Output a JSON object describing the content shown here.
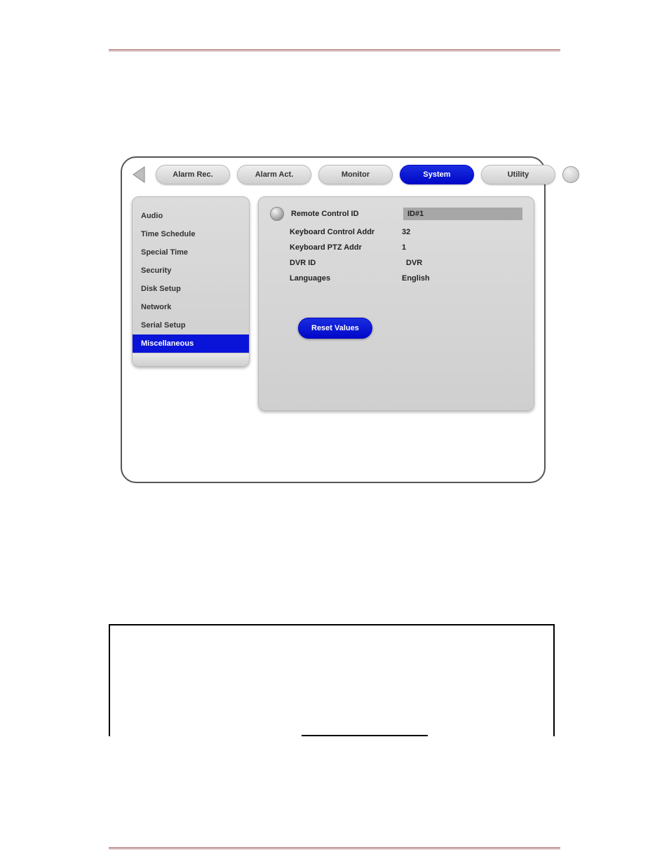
{
  "tabs": {
    "items": [
      {
        "label": "Alarm Rec."
      },
      {
        "label": "Alarm Act."
      },
      {
        "label": "Monitor"
      },
      {
        "label": "System"
      },
      {
        "label": "Utility"
      }
    ],
    "active_index": 3
  },
  "sidebar": {
    "items": [
      {
        "label": "Audio"
      },
      {
        "label": "Time Schedule"
      },
      {
        "label": "Special Time"
      },
      {
        "label": "Security"
      },
      {
        "label": "Disk Setup"
      },
      {
        "label": "Network"
      },
      {
        "label": "Serial Setup"
      },
      {
        "label": "Miscellaneous"
      }
    ],
    "active_index": 7
  },
  "settings": {
    "rows": [
      {
        "label": "Remote Control ID",
        "value": "ID#1",
        "highlighted": true
      },
      {
        "label": "Keyboard Control Addr",
        "value": "32",
        "highlighted": false
      },
      {
        "label": "Keyboard PTZ Addr",
        "value": "1",
        "highlighted": false
      },
      {
        "label": "DVR ID",
        "value": "DVR",
        "highlighted": false
      },
      {
        "label": "Languages",
        "value": "English",
        "highlighted": false
      }
    ],
    "reset_label": "Reset Values"
  }
}
